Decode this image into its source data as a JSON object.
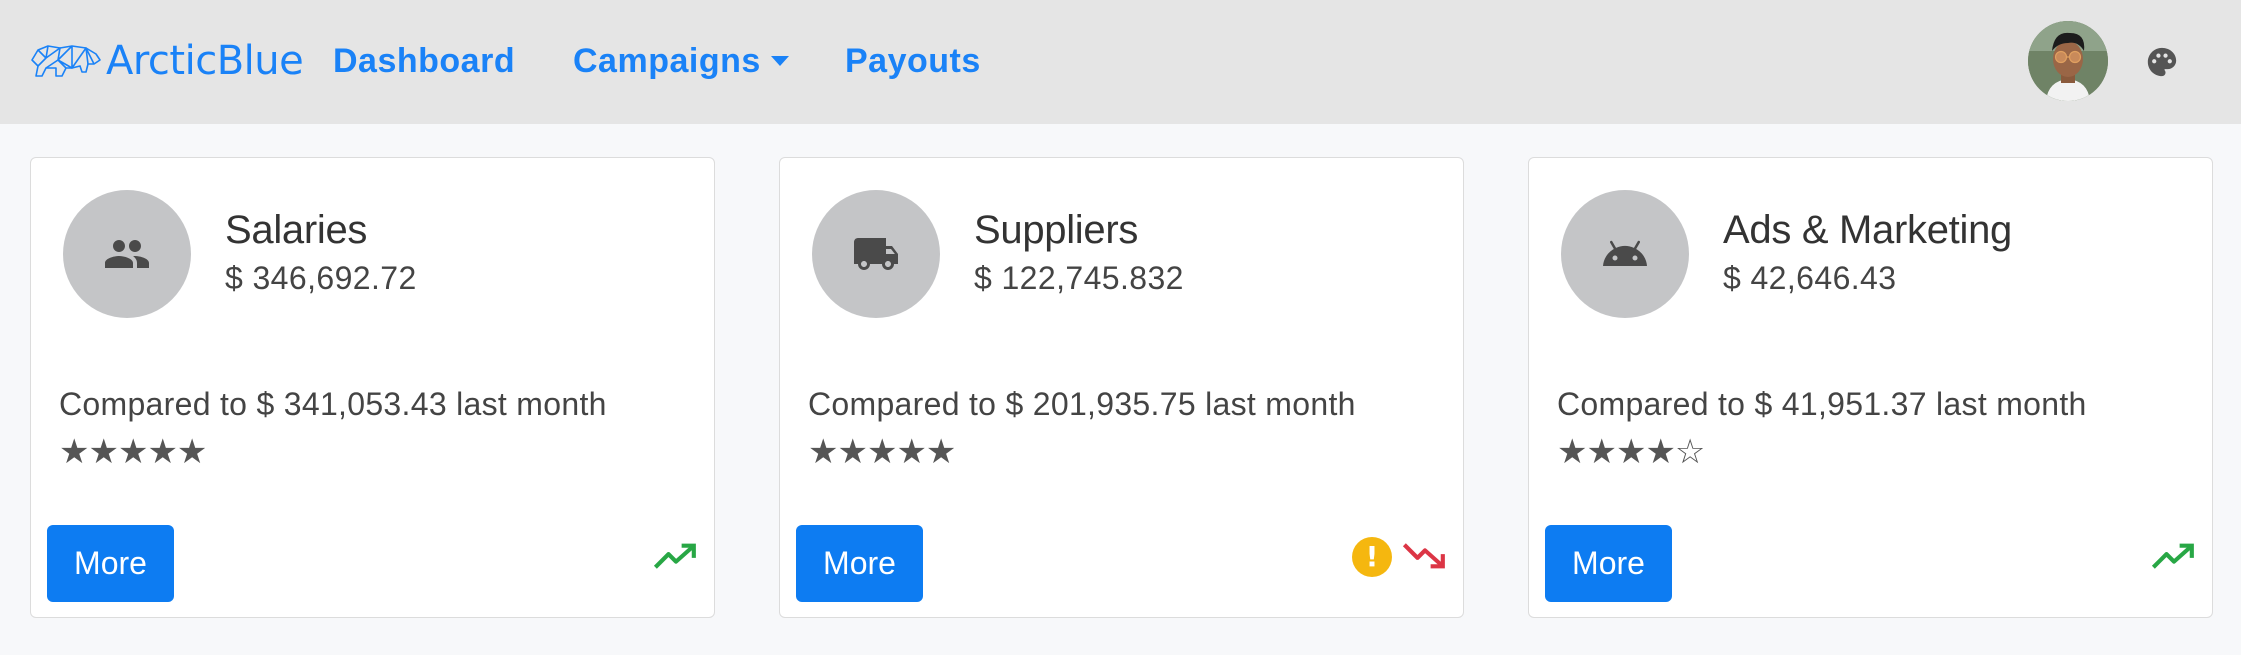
{
  "navbar": {
    "brand": "ArcticBlue",
    "links": [
      {
        "label": "Dashboard"
      },
      {
        "label": "Campaigns"
      },
      {
        "label": "Payouts"
      }
    ]
  },
  "cards": [
    {
      "icon": "people-icon",
      "title": "Salaries",
      "amount": "$ 346,692.72",
      "compare": "Compared to $ 341,053.43 last month",
      "rating_text": "★★★★★",
      "rating": 5,
      "button": "More",
      "trend": "trending-up-icon",
      "warning": false
    },
    {
      "icon": "truck-icon",
      "title": "Suppliers",
      "amount": "$ 122,745.832",
      "compare": "Compared to $ 201,935.75 last month",
      "rating_text": "★★★★★",
      "rating": 5,
      "button": "More",
      "trend": "trending-down-icon",
      "warning": true
    },
    {
      "icon": "android-icon",
      "title": "Ads & Marketing",
      "amount": "$ 42,646.43",
      "compare": "Compared to $ 41,951.37 last month",
      "rating_text": "★★★★☆",
      "rating": 4,
      "button": "More",
      "trend": "trending-up-icon",
      "warning": false
    }
  ],
  "colors": {
    "accent": "#1a82f7",
    "button": "#0d7cf2",
    "trend_up": "#28a745",
    "trend_down": "#dc3545",
    "warning": "#f5b70f"
  }
}
